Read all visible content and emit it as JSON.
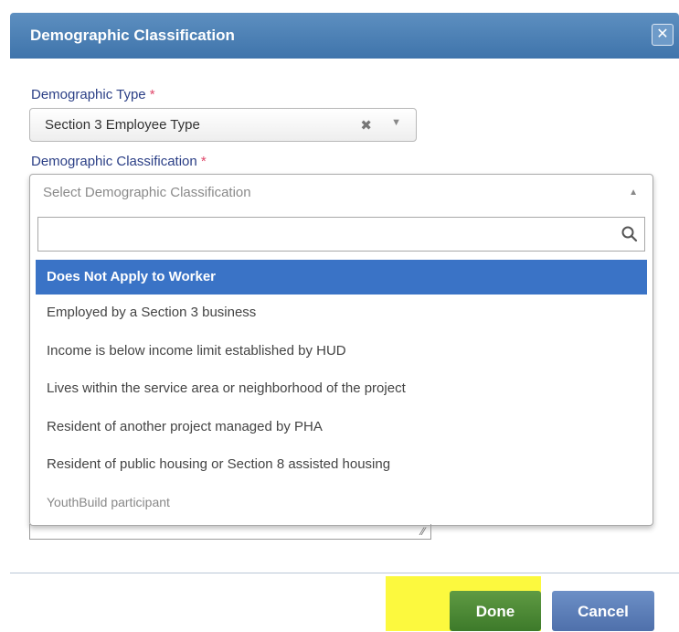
{
  "dialog": {
    "title": "Demographic Classification"
  },
  "demographic_type": {
    "label": "Demographic Type",
    "required_mark": "*",
    "value": "Section 3 Employee Type"
  },
  "demographic_classification": {
    "label": "Demographic Classification",
    "required_mark": "*",
    "placeholder": "Select Demographic Classification",
    "options": [
      "Does Not Apply to Worker",
      "Employed by a Section 3 business",
      "Income is below income limit established by HUD",
      "Lives within the service area or neighborhood of the project",
      "Resident of another project managed by PHA",
      "Resident of public housing or Section 8 assisted housing",
      "YouthBuild participant"
    ],
    "highlighted_option": "Does Not Apply to Worker"
  },
  "footer": {
    "done_label": "Done",
    "cancel_label": "Cancel"
  },
  "colors": {
    "title_bar": "#4a7fb5",
    "highlight_option": "#3a73c6",
    "done_button": "#4a8636",
    "cancel_button": "#5b7dba",
    "annotation_highlight": "#fcf93e"
  },
  "icons": [
    "close-icon",
    "clear-icon",
    "chevron-down-icon",
    "chevron-up-icon",
    "search-icon",
    "resize-grip-icon"
  ]
}
